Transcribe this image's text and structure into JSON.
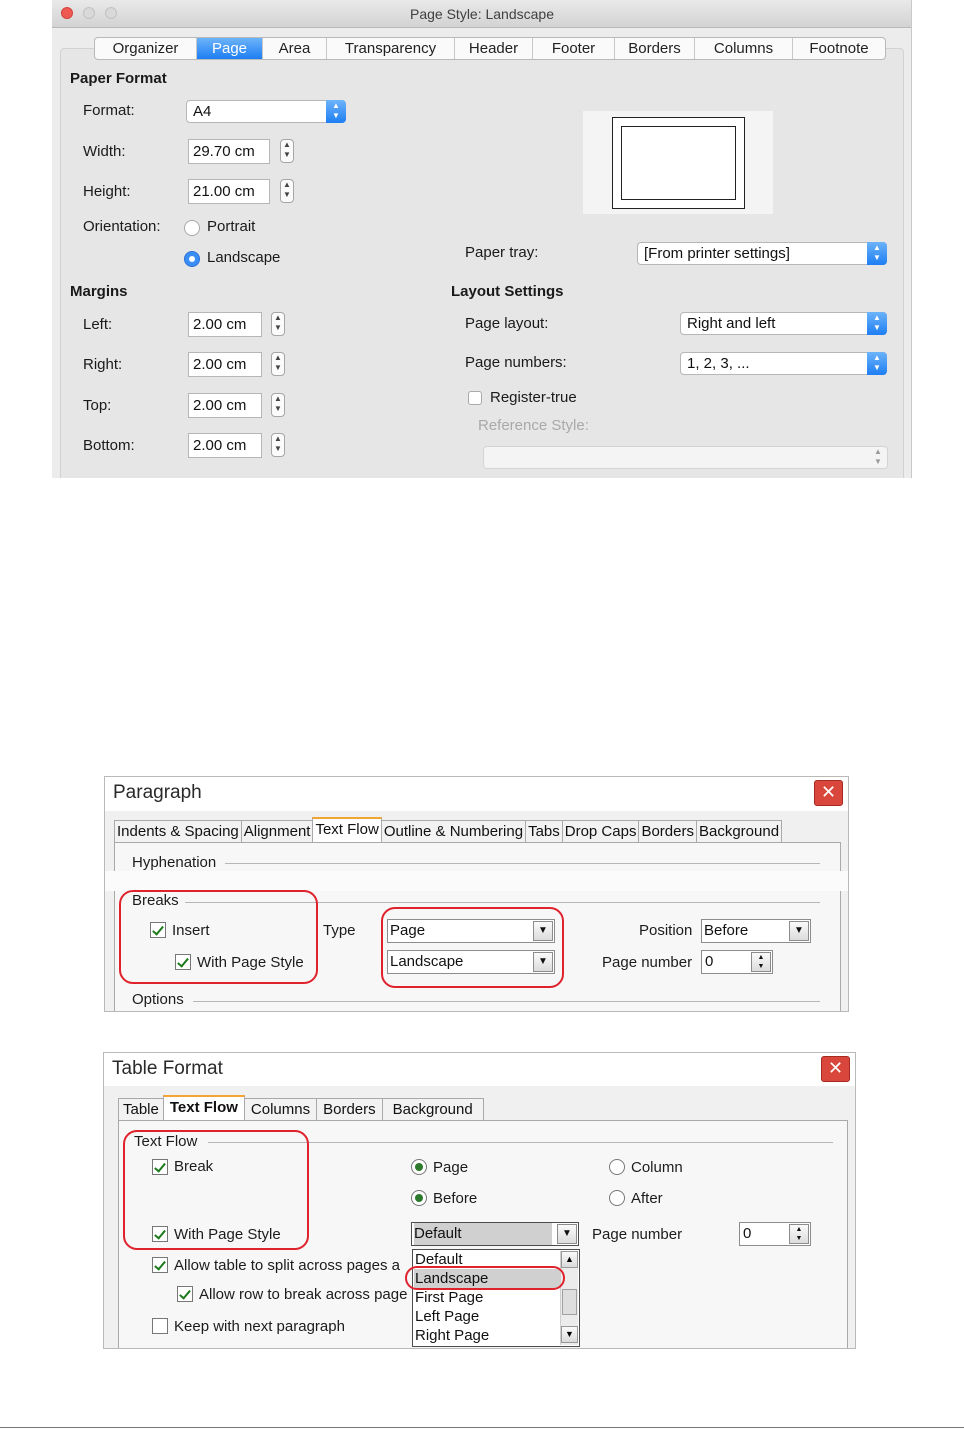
{
  "page_style": {
    "title": "Page Style: Landscape",
    "tabs": [
      "Organizer",
      "Page",
      "Area",
      "Transparency",
      "Header",
      "Footer",
      "Borders",
      "Columns",
      "Footnote"
    ],
    "active_tab": "Page",
    "paper_format": {
      "heading": "Paper Format",
      "format_label": "Format:",
      "format_value": "A4",
      "width_label": "Width:",
      "width_value": "29.70 cm",
      "height_label": "Height:",
      "height_value": "21.00 cm",
      "orientation_label": "Orientation:",
      "portrait_label": "Portrait",
      "landscape_label": "Landscape",
      "orientation_selected": "Landscape"
    },
    "paper_tray": {
      "label": "Paper tray:",
      "value": "[From printer settings]"
    },
    "margins": {
      "heading": "Margins",
      "left_label": "Left:",
      "left_value": "2.00 cm",
      "right_label": "Right:",
      "right_value": "2.00 cm",
      "top_label": "Top:",
      "top_value": "2.00 cm",
      "bottom_label": "Bottom:",
      "bottom_value": "2.00 cm"
    },
    "layout_settings": {
      "heading": "Layout Settings",
      "page_layout_label": "Page layout:",
      "page_layout_value": "Right and left",
      "page_numbers_label": "Page numbers:",
      "page_numbers_value": "1, 2, 3, ...",
      "register_true_label": "Register-true",
      "register_true_checked": false,
      "reference_style_label": "Reference Style:",
      "reference_style_value": ""
    }
  },
  "paragraph": {
    "title": "Paragraph",
    "tabs": [
      "Indents & Spacing",
      "Alignment",
      "Text Flow",
      "Outline & Numbering",
      "Tabs",
      "Drop Caps",
      "Borders",
      "Background"
    ],
    "active_tab": "Text Flow",
    "hyphenation_label": "Hyphenation",
    "breaks_label": "Breaks",
    "insert_label": "Insert",
    "insert_checked": true,
    "with_page_style_label": "With Page Style",
    "with_page_style_checked": true,
    "type_label": "Type",
    "type_value": "Page",
    "page_style_value": "Landscape",
    "position_label": "Position",
    "position_value": "Before",
    "page_number_label": "Page number",
    "page_number_value": "0",
    "options_label": "Options"
  },
  "table_format": {
    "title": "Table Format",
    "tabs": [
      "Table",
      "Text Flow",
      "Columns",
      "Borders",
      "Background"
    ],
    "active_tab": "Text Flow",
    "text_flow_label": "Text Flow",
    "break_label": "Break",
    "break_checked": true,
    "page_label": "Page",
    "column_label": "Column",
    "before_label": "Before",
    "after_label": "After",
    "with_page_style_label": "With Page Style",
    "with_page_style_checked": true,
    "page_style_value": "Default",
    "page_number_label": "Page number",
    "page_number_value": "0",
    "allow_split_label": "Allow table to split across pages a",
    "allow_row_break_label": "Allow row to break across page",
    "keep_with_next_label": "Keep with next paragraph",
    "keep_with_next_checked": false,
    "dropdown_options": [
      "Default",
      "Landscape",
      "First Page",
      "Left Page",
      "Right Page"
    ],
    "dropdown_highlighted": "Landscape"
  },
  "colors": {
    "highlight_red": "#e0222d",
    "mac_accent": "#1e7ef3",
    "tab_accent": "#f3a531"
  }
}
